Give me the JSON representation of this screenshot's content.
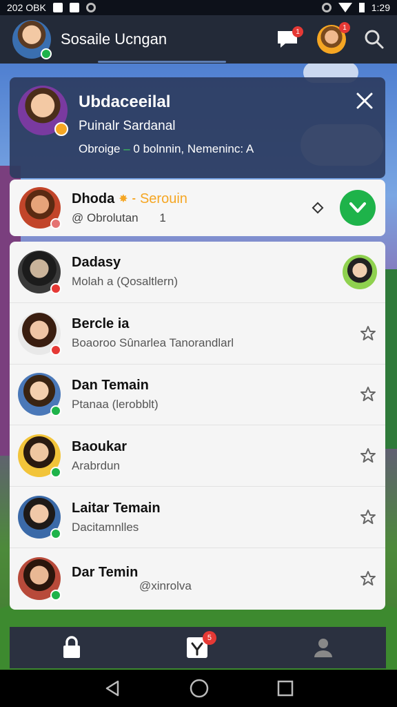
{
  "status_bar": {
    "time_left": "202 OBK",
    "time_right": "1:29"
  },
  "app_bar": {
    "title": "Sosaile Ucngan",
    "chat_badge": "1",
    "profile_badge": "1"
  },
  "profile_card": {
    "name": "Ubdaceeilal",
    "subtitle": "Puinalr Sardanal",
    "meta_prefix": "Obroige",
    "meta_dot": " – ",
    "meta_suffix": "0 bolnnin, Nemeninc: A"
  },
  "request": {
    "name": "Dhoda",
    "tag": "Serouin",
    "handle": "@ Obrolutan",
    "count": "1"
  },
  "contacts": [
    {
      "name": "Dadasy",
      "sub": "Molah a (Qosaltlern)",
      "trailing": "avatar",
      "badge": "#e53935"
    },
    {
      "name": "Bercle ia",
      "sub": "Boaoroo Sûnarlea Tanorandlarl",
      "trailing": "star",
      "badge": "#e53935"
    },
    {
      "name": "Dan Temain",
      "sub": "Ptanaa (lerobblt)",
      "trailing": "star",
      "badge": "#1eb34a"
    },
    {
      "name": "Baoukar",
      "sub": "Arabrdun",
      "trailing": "star",
      "badge": "#1eb34a"
    },
    {
      "name": "Laitar Temain",
      "sub": "Dacitamnlles",
      "trailing": "star",
      "badge": "#1eb34a"
    },
    {
      "name": "Dar Temin",
      "sub": "@xinrolva",
      "trailing": "star",
      "badge": "#1eb34a"
    }
  ],
  "bottom_nav": {
    "inbox_badge": "5"
  },
  "colors": {
    "accent": "#1eb34a",
    "alert": "#e53935",
    "appbar": "#232a38"
  },
  "icons": [
    "lock-icon",
    "inbox-check-icon",
    "person-icon",
    "search-icon",
    "chat-icon",
    "close-icon",
    "star-icon",
    "checkmark-icon",
    "back-icon",
    "home-icon",
    "recents-icon"
  ]
}
